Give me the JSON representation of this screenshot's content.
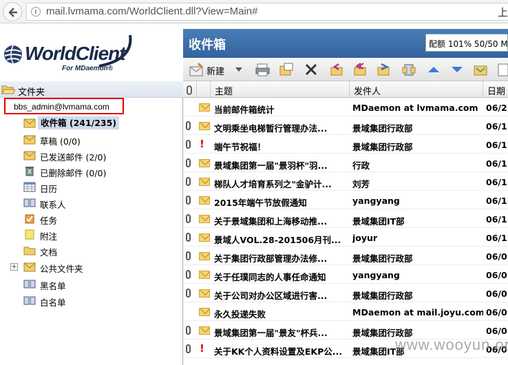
{
  "browser": {
    "url": "mail.lvmama.com/WorldClient.dll?View=Main#",
    "right_edge_text": "上"
  },
  "brand": {
    "logo_text": "WorldClient",
    "logo_sub": "For MDaemon®"
  },
  "header": {
    "folder_title": "收件箱",
    "quota": "配额 101% 50/50 M"
  },
  "toolbar": {
    "new_label": "新建"
  },
  "sidebar": {
    "folders_label": "文件夹",
    "account": "bbs_admin@lvmama.com",
    "items": [
      {
        "label": "收件箱 (241/235)",
        "icon": "inbox-icon"
      },
      {
        "label": "草稿 (0/0)",
        "icon": "drafts-icon"
      },
      {
        "label": "已发送邮件 (2/0)",
        "icon": "sent-icon"
      },
      {
        "label": "已删除邮件 (0/0)",
        "icon": "trash-icon"
      },
      {
        "label": "日历",
        "icon": "calendar-icon"
      },
      {
        "label": "联系人",
        "icon": "contacts-icon"
      },
      {
        "label": "任务",
        "icon": "tasks-icon"
      },
      {
        "label": "附注",
        "icon": "notes-icon"
      },
      {
        "label": "文档",
        "icon": "documents-icon"
      },
      {
        "label": "公共文件夹",
        "icon": "public-folder-icon"
      },
      {
        "label": "黑名单",
        "icon": "blacklist-icon"
      },
      {
        "label": "白名单",
        "icon": "whitelist-icon"
      }
    ]
  },
  "list": {
    "columns": {
      "subject": "主题",
      "sender": "发件人",
      "date": "日期"
    },
    "rows": [
      {
        "attach": false,
        "flag": false,
        "subject": "当前邮件箱统计",
        "sender": "MDaemon at lvmama.com",
        "date": "06/2"
      },
      {
        "attach": true,
        "flag": false,
        "subject": "文明乘坐电梯暂行管理办法...",
        "sender": "景域集团行政部",
        "date": "06/1"
      },
      {
        "attach": true,
        "flag": true,
        "subject": "端午节祝福！",
        "sender": "景域集团行政部",
        "date": "06/1"
      },
      {
        "attach": true,
        "flag": false,
        "subject": "景域集团第一届\"景羽杯\"羽...",
        "sender": "行政",
        "date": "06/1"
      },
      {
        "attach": true,
        "flag": false,
        "subject": "梯队人才培育系列之\"金驴计...",
        "sender": "刘芳",
        "date": "06/1"
      },
      {
        "attach": true,
        "flag": false,
        "subject": "2015年端午节放假通知",
        "sender": "yangyang",
        "date": "06/1"
      },
      {
        "attach": true,
        "flag": false,
        "subject": "关于景域集团和上海移动推...",
        "sender": "景域集团IT部",
        "date": "06/1"
      },
      {
        "attach": true,
        "flag": false,
        "subject": "景域人VOL.28-201506月刊...",
        "sender": "joyur",
        "date": "06/1"
      },
      {
        "attach": true,
        "flag": false,
        "subject": "关于集团行政部管理办法修...",
        "sender": "景域集团行政部",
        "date": "06/0"
      },
      {
        "attach": true,
        "flag": false,
        "subject": "关于任璞同志的人事任命通知",
        "sender": "yangyang",
        "date": "06/0"
      },
      {
        "attach": true,
        "flag": false,
        "subject": "关于公司对办公区域进行害...",
        "sender": "景域集团行政部",
        "date": "06/0"
      },
      {
        "attach": false,
        "flag": false,
        "subject": "永久投递失败",
        "sender": "MDaemon at mail.joyu.com",
        "date": "06/0"
      },
      {
        "attach": true,
        "flag": false,
        "subject": "景域集团第一届\"景友\"杯兵...",
        "sender": "景域集团行政部",
        "date": "06/0"
      },
      {
        "attach": true,
        "flag": true,
        "subject": "关于KK个人资料设置及EKP公...",
        "sender": "景域集团IT部",
        "date": "06/0"
      }
    ]
  },
  "watermark": "www.wooyun.org"
}
